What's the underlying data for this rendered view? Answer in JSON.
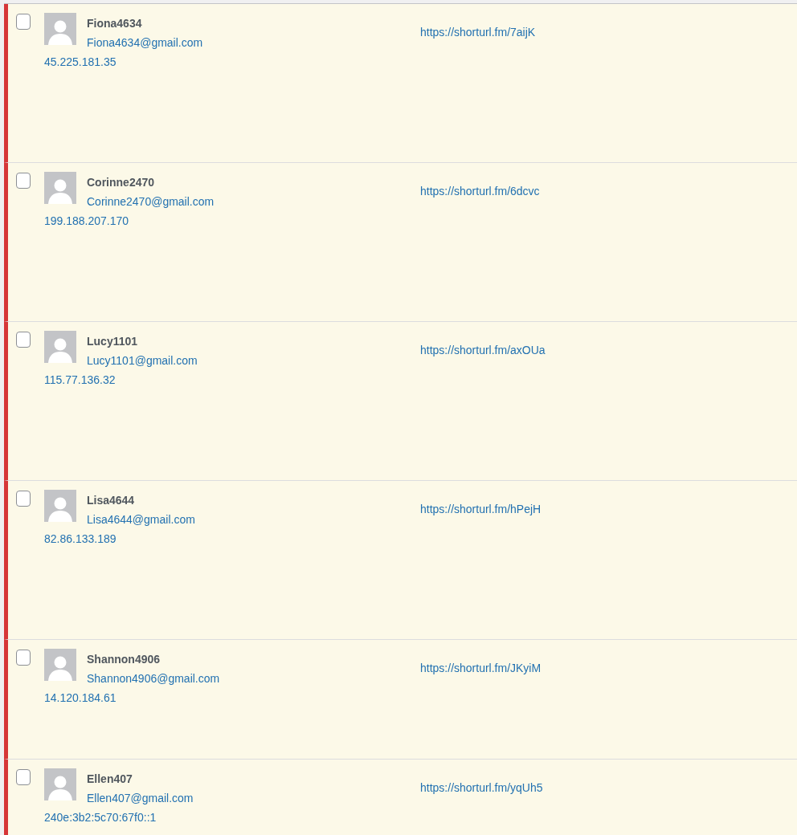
{
  "comments": [
    {
      "author": "Fiona4634",
      "email": "Fiona4634@gmail.com",
      "ip": "45.225.181.35",
      "url": "https://shorturl.fm/7aijK",
      "checked": false,
      "unapproved": true
    },
    {
      "author": "Corinne2470",
      "email": "Corinne2470@gmail.com",
      "ip": "199.188.207.170",
      "url": "https://shorturl.fm/6dcvc",
      "checked": false,
      "unapproved": true
    },
    {
      "author": "Lucy1101",
      "email": "Lucy1101@gmail.com",
      "ip": "115.77.136.32",
      "url": "https://shorturl.fm/axOUa",
      "checked": false,
      "unapproved": true
    },
    {
      "author": "Lisa4644",
      "email": "Lisa4644@gmail.com",
      "ip": "82.86.133.189",
      "url": "https://shorturl.fm/hPejH",
      "checked": false,
      "unapproved": true
    },
    {
      "author": "Shannon4906",
      "email": "Shannon4906@gmail.com",
      "ip": "14.120.184.61",
      "url": "https://shorturl.fm/JKyiM",
      "checked": false,
      "unapproved": true
    },
    {
      "author": "Ellen407",
      "email": "Ellen407@gmail.com",
      "ip": "240e:3b2:5c70:67f0::1",
      "url": "https://shorturl.fm/yqUh5",
      "checked": false,
      "unapproved": true
    }
  ]
}
